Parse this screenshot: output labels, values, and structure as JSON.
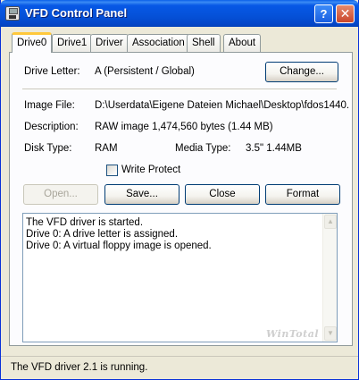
{
  "window": {
    "title": "VFD Control Panel",
    "help_label": "?",
    "close_label": "✕"
  },
  "tabs": [
    {
      "label": "Drive0",
      "active": true
    },
    {
      "label": "Drive1"
    },
    {
      "label": "Driver"
    },
    {
      "label": "Association"
    },
    {
      "label": "Shell"
    },
    {
      "label": "About"
    }
  ],
  "drive": {
    "letter_label": "Drive Letter:",
    "letter_value": "A (Persistent / Global)",
    "change_label": "Change...",
    "image_file_label": "Image File:",
    "image_file_value": "D:\\Userdata\\Eigene Dateien Michael\\Desktop\\fdos1440.",
    "description_label": "Description:",
    "description_value": "RAW image 1,474,560 bytes (1.44 MB)",
    "disk_type_label": "Disk Type:",
    "disk_type_value": "RAM",
    "media_type_label": "Media Type:",
    "media_type_value": "3.5\"  1.44MB",
    "write_protect_label": "Write Protect",
    "write_protect_checked": false
  },
  "actions": {
    "open_label": "Open...",
    "save_label": "Save...",
    "close_label": "Close",
    "format_label": "Format"
  },
  "log": {
    "lines": [
      "The VFD driver is started.",
      "Drive 0: A drive letter is assigned.",
      "Drive 0: A virtual floppy image is opened."
    ],
    "watermark": "WinTotal"
  },
  "status": {
    "text": "The VFD driver 2.1 is running."
  },
  "icons": {
    "app": "floppy-icon",
    "scroll_up": "scroll-up-arrow-icon",
    "scroll_down": "scroll-down-arrow-icon"
  },
  "colors": {
    "titlebar": "#0551d8",
    "active_tab_accent": "#ffc83c",
    "dialog_bg": "#ece9d8",
    "close_button": "#c9462b"
  }
}
